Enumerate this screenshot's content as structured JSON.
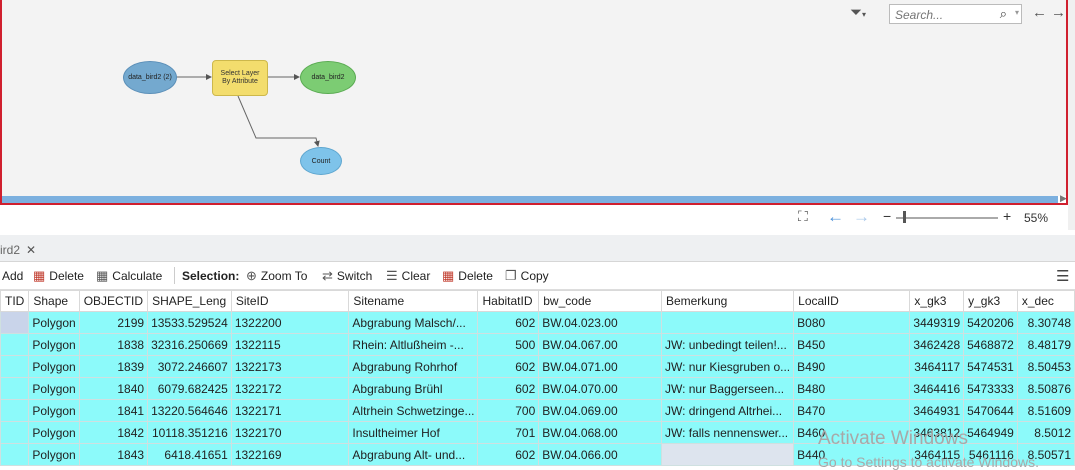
{
  "search": {
    "placeholder": "Search..."
  },
  "diagram": {
    "input_node": "data_bird2 (2)",
    "tool_node": "Select Layer By Attribute",
    "output_node": "data_bird2",
    "count_node": "Count"
  },
  "zoom": {
    "percent": "55%"
  },
  "tab": {
    "label": "ird2"
  },
  "toolbar": {
    "add": "Add",
    "delete": "Delete",
    "calculate": "Calculate",
    "selection": "Selection:",
    "zoom_to": "Zoom To",
    "switch": "Switch",
    "clear": "Clear",
    "delete2": "Delete",
    "copy": "Copy"
  },
  "table": {
    "columns": [
      "TID",
      "Shape",
      "OBJECTID",
      "SHAPE_Leng",
      "SiteID",
      "Sitename",
      "HabitatID",
      "bw_code",
      "Bemerkung",
      "LocalID",
      "x_gk3",
      "y_gk3",
      "x_dec"
    ],
    "rows": [
      [
        "",
        "Polygon",
        "2199",
        "13533.529524",
        "1322200",
        "Abgrabung Malsch/...",
        "602",
        "BW.04.023.00",
        "",
        "B080",
        "3449319",
        "5420206",
        "8.30748"
      ],
      [
        "",
        "Polygon",
        "1838",
        "32316.250669",
        "1322115",
        "Rhein: Altlußheim -...",
        "500",
        "BW.04.067.00",
        "JW: unbedingt teilen!...",
        "B450",
        "3462428",
        "5468872",
        "8.48179"
      ],
      [
        "",
        "Polygon",
        "1839",
        "3072.246607",
        "1322173",
        "Abgrabung Rohrhof",
        "602",
        "BW.04.071.00",
        "JW: nur Kiesgruben o...",
        "B490",
        "3464117",
        "5474531",
        "8.50453"
      ],
      [
        "",
        "Polygon",
        "1840",
        "6079.682425",
        "1322172",
        "Abgrabung Brühl",
        "602",
        "BW.04.070.00",
        "JW: nur Baggerseen...",
        "B480",
        "3464416",
        "5473333",
        "8.50876"
      ],
      [
        "",
        "Polygon",
        "1841",
        "13220.564646",
        "1322171",
        "Altrhein Schwetzinge...",
        "700",
        "BW.04.069.00",
        "JW: dringend Altrhei...",
        "B470",
        "3464931",
        "5470644",
        "8.51609"
      ],
      [
        "",
        "Polygon",
        "1842",
        "10118.351216",
        "1322170",
        "Insultheimer Hof",
        "701",
        "BW.04.068.00",
        "JW: falls nennenswer...",
        "B460",
        "3463812",
        "5464949",
        "8.5012"
      ],
      [
        "",
        "Polygon",
        "1843",
        "6418.41651",
        "1322169",
        "Abgrabung Alt- und...",
        "602",
        "BW.04.066.00",
        "",
        "B440",
        "3464115",
        "5461116",
        "8.50571"
      ]
    ]
  },
  "watermark": {
    "line1": "Activate Windows",
    "line2": "Go to Settings to activate Windows."
  },
  "colors": {
    "selected_row": "#8cfafa",
    "accent": "#4a90d9",
    "border": "#d01f2e"
  }
}
